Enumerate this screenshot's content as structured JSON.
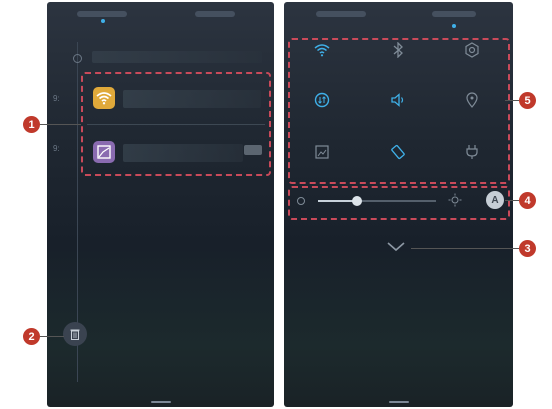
{
  "left_screen": {
    "timeline_labels": [
      "9:",
      "9:"
    ],
    "notifications": [
      {
        "app": "wifi",
        "icon": "wifi-icon",
        "color": "#e0a93a"
      },
      {
        "app": "gallery",
        "icon": "image-icon",
        "color": "#8a6bb0"
      }
    ],
    "delete_button_icon": "trash-icon"
  },
  "right_screen": {
    "toggles": [
      {
        "id": "wifi",
        "icon": "wifi-icon",
        "active": true
      },
      {
        "id": "bluetooth",
        "icon": "bluetooth-icon",
        "active": false
      },
      {
        "id": "settings",
        "icon": "gear-icon",
        "active": false
      },
      {
        "id": "data",
        "icon": "mobile-data-icon",
        "active": true
      },
      {
        "id": "sound",
        "icon": "speaker-icon",
        "active": true
      },
      {
        "id": "location",
        "icon": "location-pin-icon",
        "active": false
      },
      {
        "id": "screenshot",
        "icon": "screenshot-icon",
        "active": false
      },
      {
        "id": "auto-rotate",
        "icon": "rotate-icon",
        "active": true
      },
      {
        "id": "power-saving",
        "icon": "plug-icon",
        "active": false
      }
    ],
    "brightness_level": 0.33,
    "auto_brightness_label": "A",
    "expand_icon": "chevron-down-icon"
  },
  "callouts": [
    "1",
    "2",
    "3",
    "4",
    "5"
  ],
  "colors": {
    "accent_active": "#3fb0e8",
    "icon_inactive": "#7f8b97",
    "dashed_frame": "#c94a5a",
    "callout": "#c0392b"
  }
}
